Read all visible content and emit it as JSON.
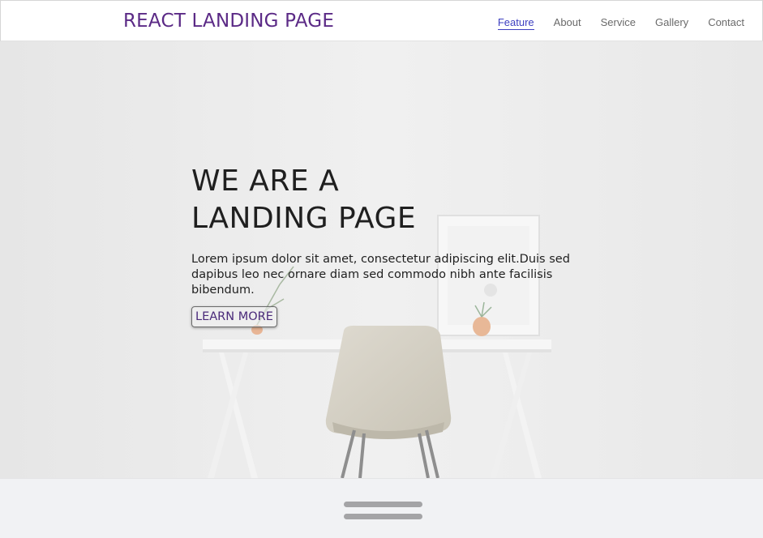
{
  "navbar": {
    "brand": "REACT LANDING PAGE",
    "links": [
      {
        "label": "Feature",
        "active": true
      },
      {
        "label": "About",
        "active": false
      },
      {
        "label": "Service",
        "active": false
      },
      {
        "label": "Gallery",
        "active": false
      },
      {
        "label": "Contact",
        "active": false
      }
    ]
  },
  "hero": {
    "title_line1": "WE ARE A",
    "title_line2": "LANDING PAGE",
    "text": "Lorem ipsum dolor sit amet, consectetur adipiscing elit.Duis sed dapibus leo nec ornare diam sed commodo nibh ante facilisis bibendum.",
    "button_label": "LEARN MORE"
  },
  "colors": {
    "brand": "#5b2a86",
    "active_link": "#3d3fc0",
    "nav_link": "#6a6a6a",
    "hero_text": "#1f1f1f",
    "bottom_panel": "#f1f2f4"
  },
  "bottom_panel": {
    "icon": "drag-handle-icon"
  }
}
